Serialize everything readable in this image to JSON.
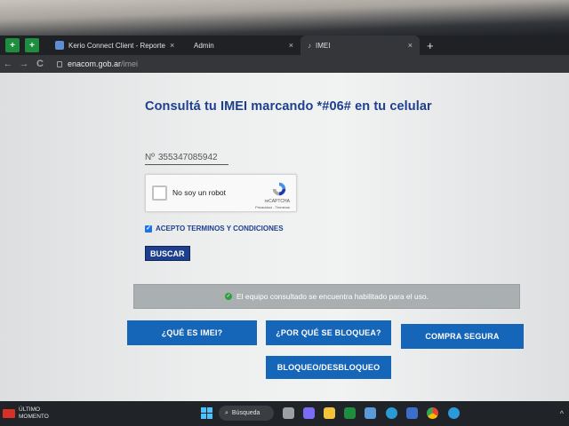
{
  "browser": {
    "pinned_tabs": [
      "+",
      "+"
    ],
    "tabs": [
      {
        "label": "Kerio Connect Client - Reporte",
        "close": "×"
      },
      {
        "label": "Admin",
        "close": "×"
      },
      {
        "label": "IMEI",
        "close": "×"
      }
    ],
    "new_tab": "+",
    "nav": {
      "back": "←",
      "forward": "→",
      "reload": "C"
    },
    "url_host": "enacom.gob.ar",
    "url_path": "/imei"
  },
  "page": {
    "title": "Consultá tu IMEI marcando *#06# en tu celular",
    "imei_prefix": "Nº",
    "imei_value": "355347085942",
    "captcha": {
      "label": "No soy un robot",
      "brand": "reCAPTCHA",
      "links": "Privacidad - Términos"
    },
    "accept_label": "ACEPTO TERMINOS Y CONDICIONES",
    "accept_checked": true,
    "search_button": "BUSCAR",
    "status_message": "El equipo consultado se encuentra habilitado para el uso.",
    "buttons": {
      "what_is_imei": "¿QUÉ ES IMEI?",
      "why_blocked": "¿POR QUÉ SE BLOQUEA?",
      "safe_purchase": "COMPRA SEGURA",
      "block_unblock": "BLOQUEO/DESBLOQUEO"
    }
  },
  "taskbar": {
    "news_line1": "ÚLTIMO",
    "news_line2": "MOMENTO",
    "search_label": "Búsqueda",
    "tray_arrow": "^"
  },
  "colors": {
    "brand_blue": "#1d3f8e",
    "button_blue": "#1565b8",
    "status_bg": "#aab0b1",
    "ok_green": "#2e9e3e"
  }
}
